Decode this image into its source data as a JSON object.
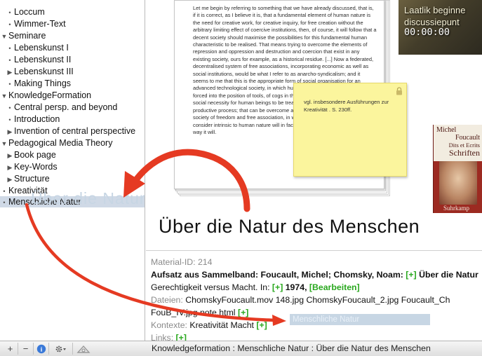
{
  "sidebar": {
    "items": [
      {
        "label": "Loccum",
        "glyph": "•"
      },
      {
        "label": "Wimmer-Text",
        "glyph": "•"
      },
      {
        "label": "Seminare",
        "glyph": "▼"
      },
      {
        "label": "Lebenskunst I",
        "glyph": "•"
      },
      {
        "label": "Lebenskunst II",
        "glyph": "•"
      },
      {
        "label": "Lebenskunst III",
        "glyph": "▶"
      },
      {
        "label": "Making Things",
        "glyph": "•"
      },
      {
        "label": "KnowledgeFormation",
        "glyph": "▼"
      },
      {
        "label": "Central persp. and beyond",
        "glyph": "•"
      },
      {
        "label": "Introduction",
        "glyph": "•"
      },
      {
        "label": "Invention of central perspective",
        "glyph": "▶"
      },
      {
        "label": "Pedagogical Media Theory",
        "glyph": "▼"
      },
      {
        "label": "Book page",
        "glyph": "▶"
      },
      {
        "label": "Key-Words",
        "glyph": "▶"
      },
      {
        "label": "Structure",
        "glyph": "▶"
      },
      {
        "label": "Kreativität",
        "glyph": "•"
      },
      {
        "label": "Menschliche Natur",
        "glyph": "•"
      }
    ],
    "drag_ghost": "Über die Natur"
  },
  "document": {
    "text": "Let me begin by referring to something that we have already discussed, that is, if it is correct, as I believe it is, that a fundamental element of human nature is the need for creative work, for creative inquiry, for free creation without the arbitrary limiting effect of coercive institutions, then, of course, it will follow that a decent society should maximise the possibilities for this fundamental human characteristic to be realised. That means trying to overcome the elements of repression and oppression and destruction and coercion that exist in any existing society, ours for example, as a historical residue. [...] Now a federated, decentralised system of free associations, incorporating economic as well as social institutions, would be what I refer to as anarcho-syndicalism; and it seems to me that this is the appropriate form of social organisation for an advanced technological society, in which human beings do not have to be forced into the position of tools, of cogs in the machine. There is no longer any social necessity for human beings to be treated as mechanical elements in the productive process; that can be overcome and we must overcome it by a society of freedom and free association, in which the creative urge that I consider intrinsic to human nature will in fact be able to realise itself in whatever way it will."
  },
  "sticky_note": {
    "text": "vgl. insbesondere Ausführungen zur Kreativität . S. 230ff."
  },
  "video": {
    "title": "Laatlik beginne\ndiscussiepunt",
    "time": "00:00:00"
  },
  "book": {
    "author_line1": "Michel",
    "author_line2": "Foucault",
    "title_line1": "Dits et Ecrits",
    "title_line2": "Schriften",
    "publisher": "Suhrkamp"
  },
  "main": {
    "title": "Über die Natur des Menschen"
  },
  "info": {
    "material_id": "Material-ID: 214",
    "line2_prefix": "Aufsatz aus Sammelband: Foucault, Michel; Chomsky, Noam: ",
    "plus": "[+]",
    "line2_suffix": " Über die Natur",
    "line3_prefix": "Gerechtigkeit versus Macht. In: ",
    "line3_year": " 1974, ",
    "edit": "[Bearbeiten]",
    "files_label": "Dateien: ",
    "files_value": "ChomskyFoucault.mov 148.jpg ChomskyFoucault_2.jpg Foucault_Ch",
    "files_line2": "FouB_IV.jpg note.html ",
    "contexts_label": "Kontexte: ",
    "contexts_value": "Kreativität Macht ",
    "drop_target": "Menschliche Natur",
    "links_label": "Links: "
  },
  "bottombar": {
    "add": "+",
    "remove": "−",
    "breadcrumb": "Knowledgeformation : Menschliche Natur : Über die Natur des Menschen"
  },
  "colors": {
    "accent_green": "#2aa81f",
    "arrow_red": "#e53a22",
    "selection": "#cfd9e6",
    "sticky": "#fbf59d"
  }
}
